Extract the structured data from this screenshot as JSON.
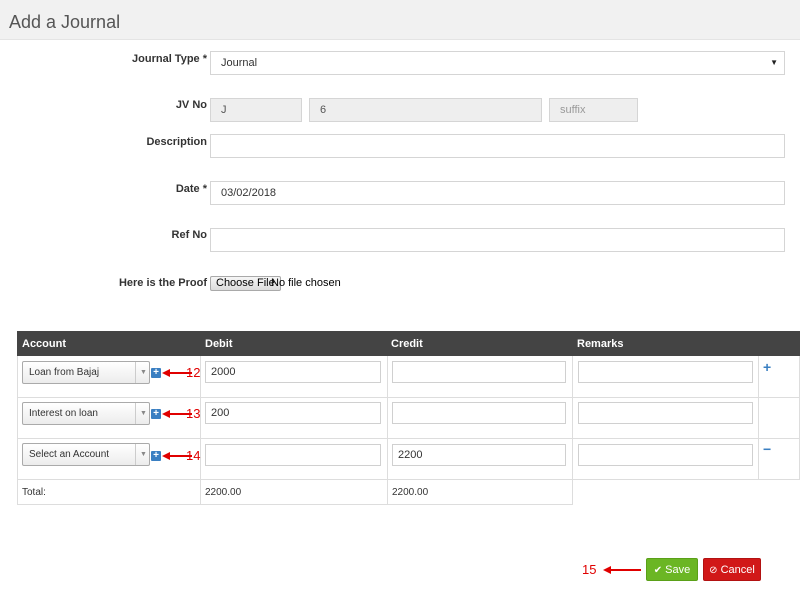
{
  "page": {
    "title": "Add a Journal"
  },
  "form": {
    "journal_type": {
      "label": "Journal Type *",
      "value": "Journal"
    },
    "jv_no": {
      "label": "JV No",
      "prefix": "J",
      "number": "6",
      "suffix_placeholder": "suffix"
    },
    "description": {
      "label": "Description",
      "value": ""
    },
    "date": {
      "label": "Date *",
      "value": "03/02/2018"
    },
    "ref_no": {
      "label": "Ref No",
      "value": ""
    },
    "proof": {
      "label": "Here is the Proof",
      "button_label": "Choose File",
      "status": "No file chosen"
    }
  },
  "table": {
    "headers": [
      "Account",
      "Debit",
      "Credit",
      "Remarks"
    ],
    "rows": [
      {
        "account": "Loan from Bajaj",
        "debit": "2000",
        "credit": "",
        "remarks": "",
        "annotation": "12"
      },
      {
        "account": "Interest on loan",
        "debit": "200",
        "credit": "",
        "remarks": "",
        "annotation": "13"
      },
      {
        "account": "Select an Account",
        "debit": "",
        "credit": "2200",
        "remarks": "",
        "annotation": "14"
      }
    ],
    "total": {
      "label": "Total:",
      "debit": "2200.00",
      "credit": "2200.00"
    },
    "add_row_symbol": "+",
    "remove_row_symbol": "−"
  },
  "actions": {
    "annotation": "15",
    "save_label": "Save",
    "cancel_label": "Cancel"
  },
  "colors": {
    "header_bg": "#444444",
    "save": "#6bb624",
    "cancel": "#d11818",
    "accent": "#3a7fc2",
    "annotation": "#e00000"
  },
  "icons": {
    "add_account": "plus-square-icon",
    "save": "check-icon",
    "cancel": "ban-icon"
  }
}
